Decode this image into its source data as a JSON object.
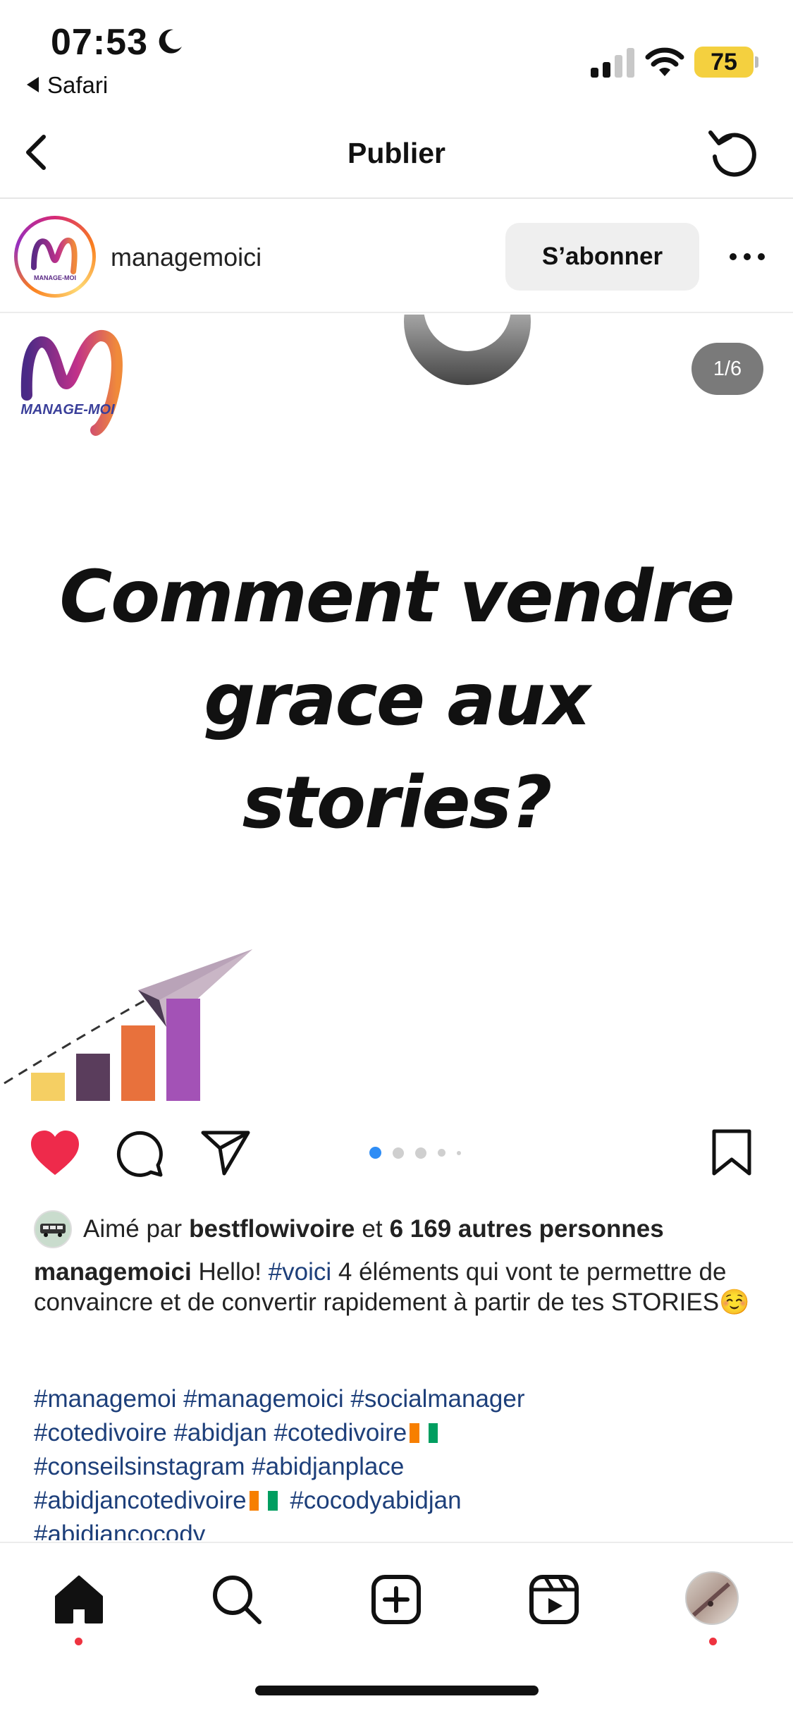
{
  "status_bar": {
    "time": "07:53",
    "back_app": "Safari",
    "battery": "75"
  },
  "nav": {
    "title": "Publier"
  },
  "post": {
    "username": "managemoici",
    "follow_label": "S’abonner",
    "logo_text": "MANAGE-MOI",
    "counter": "1/6",
    "headline_lines": [
      "Comment vendre",
      "grace aux",
      "stories?"
    ],
    "carousel": {
      "total_dots": 5,
      "active_index": 0
    }
  },
  "likes": {
    "prefix": "Aimé par",
    "user": "bestflowivoire",
    "joiner": "et",
    "others": "6 169 autres personnes"
  },
  "caption": {
    "author": "managemoici",
    "before_tag": "Hello!",
    "tag": "#voici",
    "text": "4 éléments qui vont te permettre de convaincre et de convertir rapidement à partir de tes STORIES",
    "emoji": "☺️"
  },
  "hashtags": {
    "line1": "#managemoi #managemoici #socialmanager",
    "line2": "#cotedivoire #abidjan #cotedivoire",
    "line3": "#conseilsinstagram #abidjanplace",
    "line4a": "#abidjancotedivoire",
    "line4b": "#cocodyabidjan",
    "line5": "#abidjancocody"
  },
  "colors": {
    "like_red": "#ee2a4b",
    "hashtag_blue": "#1d3f7a",
    "carousel_active": "#2f8df5",
    "battery_yellow": "#f4d03f",
    "bar1": "#f5cf63",
    "bar2": "#5a3d5c",
    "bar3": "#e8713c",
    "bar4": "#a352b6"
  },
  "icons": {
    "nav_back": "chevron-left-icon",
    "refresh": "refresh-icon",
    "like": "heart-filled-icon",
    "comment": "comment-icon",
    "share": "send-icon",
    "save": "bookmark-icon",
    "tab_home": "home-icon",
    "tab_search": "search-icon",
    "tab_create": "plus-square-icon",
    "tab_reels": "reels-icon",
    "tab_profile": "profile-avatar"
  }
}
